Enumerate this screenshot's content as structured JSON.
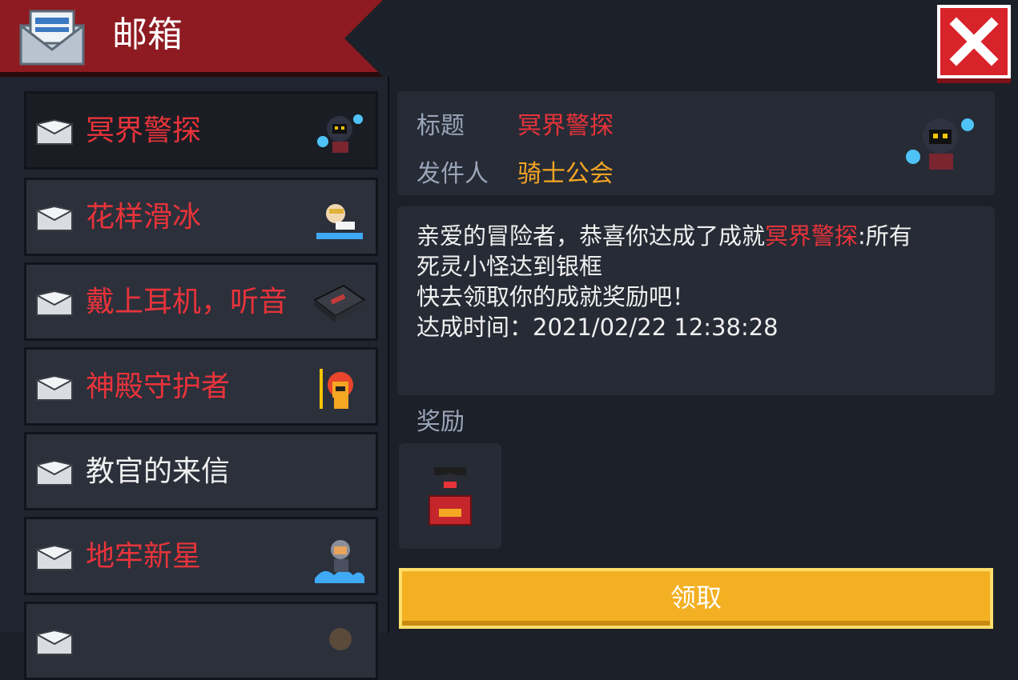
{
  "header": {
    "title": "邮箱",
    "icon": "mail-inbox-icon"
  },
  "mail_list": [
    {
      "label": "冥界警探",
      "color": "red",
      "thumb": "ghost-knight-thumb"
    },
    {
      "label": "花样滑冰",
      "color": "red",
      "thumb": "skater-thumb"
    },
    {
      "label": "戴上耳机，听音",
      "color": "red",
      "thumb": "cassette-thumb"
    },
    {
      "label": "神殿守护者",
      "color": "red",
      "thumb": "fire-guardian-thumb"
    },
    {
      "label": "教官的来信",
      "color": "white",
      "thumb": ""
    },
    {
      "label": "地牢新星",
      "color": "red",
      "thumb": "hero-wave-thumb"
    },
    {
      "label": "",
      "color": "red",
      "thumb": "partial-thumb"
    }
  ],
  "detail": {
    "title_label": "标题",
    "title_value": "冥界警探",
    "sender_label": "发件人",
    "sender_value": "骑士公会",
    "body": {
      "line1_pre": "亲爱的冒险者，恭喜你达成了成就",
      "line1_hl": "冥界警探",
      "line1_post": ":所有",
      "line2": "死灵小怪达到银框",
      "line3": "快去领取你的成就奖励吧！",
      "line4": "达成时间：2021/02/22 12:38:28"
    },
    "reward_label": "奖励",
    "claim_label": "领取"
  },
  "colors": {
    "accent_red": "#e8333a",
    "sender_orange": "#f5a623",
    "button_yellow": "#f3b022",
    "header_red": "#8e1b21"
  }
}
